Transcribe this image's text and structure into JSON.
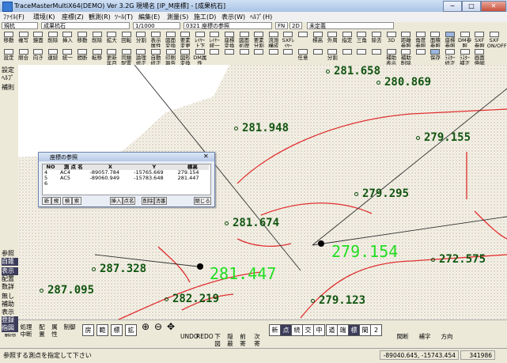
{
  "window": {
    "title": "TraceMasterMultiX64(DEMO)  Ver 3.2G  現場名 [IP_M座標] - [成果杭石]",
    "min": "─",
    "max": "□",
    "close": "✕"
  },
  "menu": [
    "ﾌｧｲﾙ(F)",
    "環境(K)",
    "座標(Z)",
    "観測(R)",
    "ﾂｰﾙ(T)",
    "編集(E)",
    "測量(S)",
    "施工(D)",
    "表示(W)",
    "ﾍﾙﾌﾟ(H)"
  ],
  "combos": {
    "layer": "規杭",
    "stake": "成果杭石",
    "scale": "1/1000",
    "coord": "0321 座標の参照",
    "fn": "FN",
    "dim": "2D",
    "unset": "未定義"
  },
  "toolbar1": [
    "移動",
    "複写",
    "鏡面",
    "削除",
    "挿入",
    "移動",
    "削除",
    "拡大",
    "回転",
    "分割",
    "表示属性",
    "図面変換",
    "要素変更",
    "ﾚｲﾔｰ上下",
    "ﾚｲﾔｰ統一",
    "座標変換",
    "図面処理",
    "要素分割",
    "流測構成",
    "SXFﾚｲﾔｰ",
    "",
    "標高",
    "外周",
    "指定",
    "三角",
    "除去",
    "3D",
    "距離参照",
    "角度参照",
    "面積参照",
    "座標参照",
    "DM参照",
    "SXF参照",
    "SXF ON/OFF"
  ],
  "toolbar2": [
    "設定",
    "閉合",
    "向き",
    "連続",
    "統一",
    "間断",
    "転移",
    "更新年月",
    "同類配置",
    "論理修正",
    "自動修正",
    "印刷報告",
    "図形変換",
    "DM属性",
    "",
    "",
    "",
    "",
    "",
    "",
    "任意",
    "",
    "分割",
    "",
    "",
    "",
    "補助表示",
    "補助削除",
    "",
    "保存",
    "ﾗｽﾀｰ修正",
    "ﾗｽﾀｰ補正",
    "画面伸縮"
  ],
  "sidebar": [
    "設定",
    "ﾍﾙﾌﾟ",
    "補則",
    "参照",
    "自錐",
    "表示",
    "配置",
    "数詳",
    "無し",
    "補助",
    "表示",
    "登録",
    "指図"
  ],
  "points": [
    {
      "label": "281.658"
    },
    {
      "label": "280.869"
    },
    {
      "label": "281.948"
    },
    {
      "label": "279.155"
    },
    {
      "label": "279.295"
    },
    {
      "label": "281.674"
    },
    {
      "label": "279.154",
      "big": true
    },
    {
      "label": "272.575"
    },
    {
      "label": "287.328"
    },
    {
      "label": "281.447",
      "big": true
    },
    {
      "label": "287.095"
    },
    {
      "label": "282.219"
    },
    {
      "label": "279.123"
    }
  ],
  "dialog": {
    "title": "座標の参照",
    "headers": [
      "NO",
      "測 点 名",
      "X",
      "Y",
      "標高"
    ],
    "rows": [
      {
        "no": "4",
        "name": "AC4",
        "x": "-89057.784",
        "y": "-15765.669",
        "z": "279.154"
      },
      {
        "no": "5",
        "name": "AC5",
        "x": "-89060.949",
        "y": "-15783.648",
        "z": "281.447"
      },
      {
        "no": "6",
        "name": "",
        "x": "",
        "y": "",
        "z": ""
      }
    ],
    "buttons_left": [
      "新",
      "規",
      "検",
      "索"
    ],
    "buttons_mid": [
      "挿入",
      "点名",
      "削除",
      "消番"
    ],
    "close": "閉じる"
  },
  "bottom": {
    "items": [
      "確定解除",
      "処理中断",
      "配置",
      "属性",
      "制御",
      "房",
      "範",
      "標",
      "拡"
    ],
    "zoom": [
      "UNDO",
      "REDO",
      "下図",
      "隠蔽",
      "前寄",
      "次寄"
    ],
    "modes": [
      "新",
      "点",
      "続",
      "交",
      "中",
      "道",
      "端",
      "標",
      "間",
      "2"
    ],
    "right": [
      "間断",
      "補字",
      "方向"
    ]
  },
  "status": {
    "message": "参照する測点を指定して下さい",
    "coords": "-89040.645, -15743.454",
    "num": "341986"
  },
  "colors": {
    "point_text": "#115511",
    "highlight": "#22dd22",
    "contour": "#e03030",
    "titlebar": "#a9c3e6"
  }
}
